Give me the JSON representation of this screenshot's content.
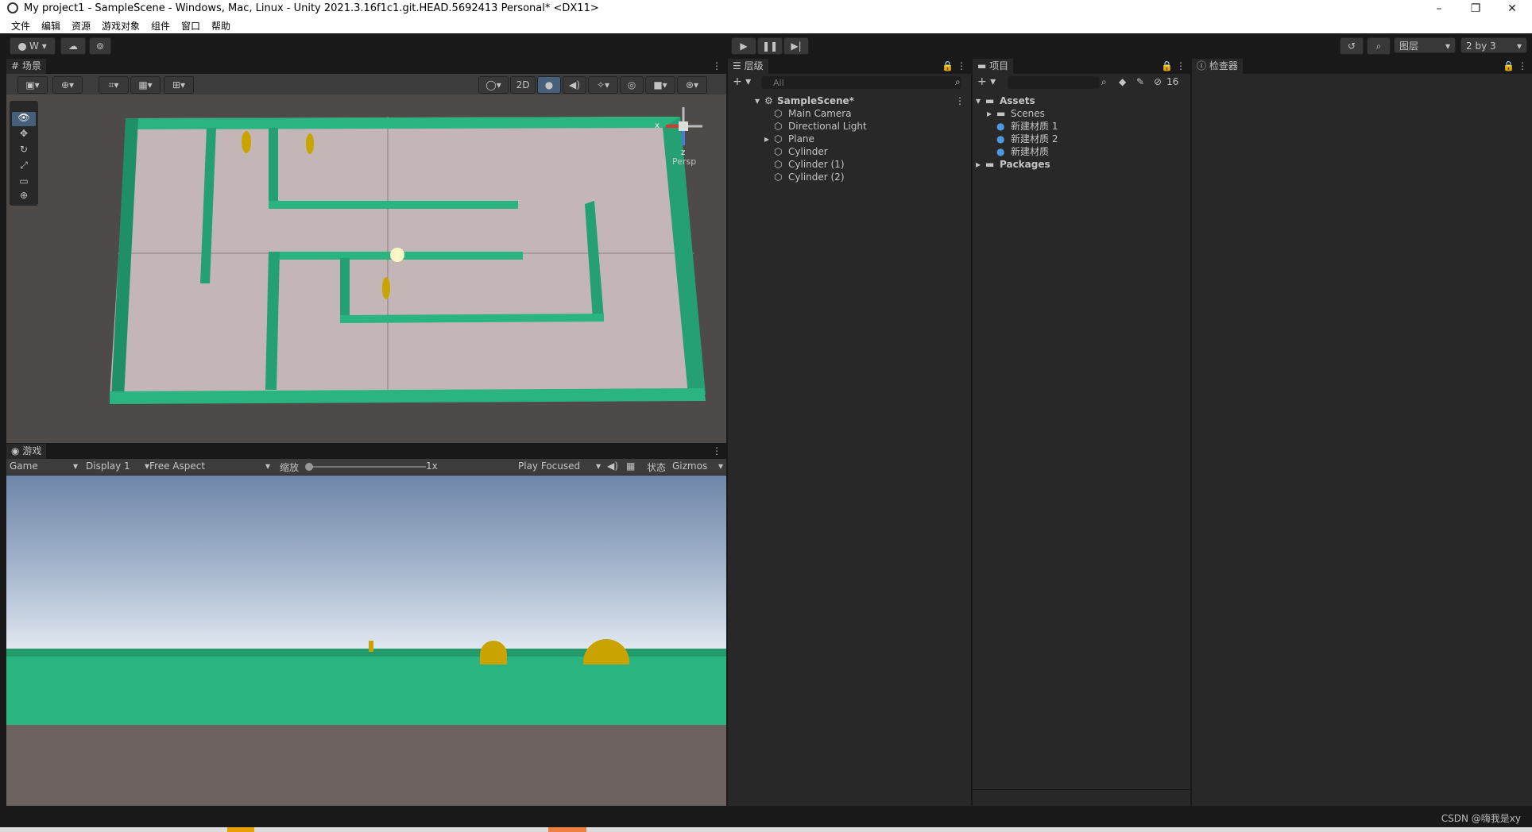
{
  "window": {
    "title": "My project1 - SampleScene - Windows, Mac, Linux - Unity 2021.3.16f1c1.git.HEAD.5692413 Personal* <DX11>",
    "minimize": "–",
    "maximize": "❐",
    "close": "✕"
  },
  "menu": [
    "文件",
    "编辑",
    "资源",
    "游戏对象",
    "组件",
    "窗口",
    "帮助"
  ],
  "toolbar": {
    "account": "W",
    "layers": "图层",
    "layout": "2 by 3"
  },
  "scene": {
    "tab": "场景",
    "mode_2d": "2D",
    "persp": "Persp",
    "gizmo_x": "x",
    "gizmo_z": "z"
  },
  "game": {
    "tab": "游戏",
    "view": "Game",
    "display": "Display 1",
    "aspect": "Free Aspect",
    "scale_label": "缩放",
    "scale_value": "1x",
    "play_mode": "Play Focused",
    "stats": "状态",
    "gizmos": "Gizmos"
  },
  "hierarchy": {
    "tab": "层级",
    "search_placeholder": "All",
    "scene": "SampleScene*",
    "items": [
      "Main Camera",
      "Directional Light",
      "Plane",
      "Cylinder",
      "Cylinder (1)",
      "Cylinder (2)"
    ]
  },
  "project": {
    "tab": "项目",
    "hidden_count": "16",
    "assets": "Assets",
    "scenes": "Scenes",
    "materials": [
      "新建材质 1",
      "新建材质 2",
      "新建材质"
    ],
    "packages": "Packages"
  },
  "inspector": {
    "tab": "检查器"
  },
  "watermark": "CSDN @嗨我是xy",
  "colors": {
    "wall": "#2ab47f",
    "floor": "#c4b6b6",
    "coin": "#c9a400",
    "sky_top": "#6e86a8",
    "game_ground": "#2ab47f"
  }
}
